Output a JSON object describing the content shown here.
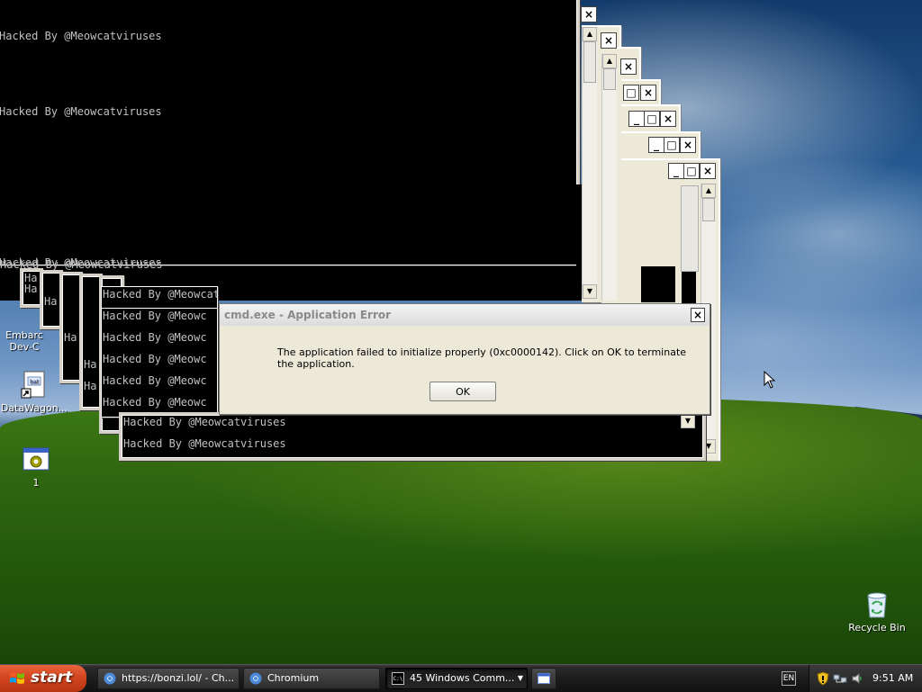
{
  "console": {
    "text": "Hacked By @Meowcatviruses",
    "fragments": {
      "a": "Ha",
      "b": "Hacked By @Meowc"
    }
  },
  "dialog": {
    "title": "cmd.exe - Application Error",
    "message": "The application failed to initialize properly (0xc0000142). Click on OK to terminate the application.",
    "ok_label": "OK",
    "close_glyph": "×"
  },
  "desktop_icons": [
    {
      "label": "Embarc Dev-C",
      "icon": "embarcadero-icon"
    },
    {
      "label": "DataWagon...",
      "icon": "shortcut-file-icon"
    },
    {
      "label": "1",
      "icon": "program-icon"
    },
    {
      "label": "Recycle Bin",
      "icon": "recycle-bin-icon"
    }
  ],
  "taskbar": {
    "start_label": "start",
    "tasks": [
      {
        "label": "https://bonzi.lol/ - Ch...",
        "icon": "chromium-icon"
      },
      {
        "label": "Chromium",
        "icon": "chromium-icon"
      },
      {
        "label": "45 Windows Comm...",
        "icon": "cmd-icon"
      },
      {
        "label": "",
        "icon": "window-icon"
      }
    ],
    "tray": {
      "language": "EN",
      "time": "9:51 AM"
    }
  },
  "colors": {
    "console_bg": "#000000",
    "console_text": "#c0c0c0",
    "start_button": "#d2451f",
    "taskbar": "#1c1c1c"
  }
}
